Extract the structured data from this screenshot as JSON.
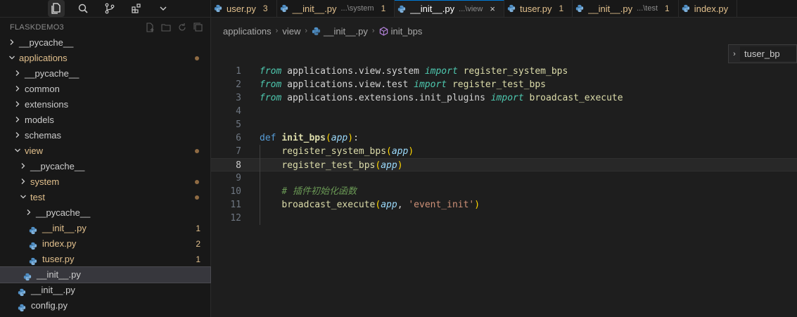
{
  "activity_bar": [
    "explorer-icon",
    "search-icon",
    "source-control-icon",
    "extensions-icon",
    "chevron-down-icon"
  ],
  "explorer": {
    "title": "FLASKDEMO3",
    "tree": [
      {
        "label": "__pycache__",
        "kind": "folder",
        "expanded": false,
        "depth": 0
      },
      {
        "label": "applications",
        "kind": "folder",
        "expanded": true,
        "depth": 0,
        "modified": true
      },
      {
        "label": "__pycache__",
        "kind": "folder",
        "expanded": false,
        "depth": 1
      },
      {
        "label": "common",
        "kind": "folder",
        "expanded": false,
        "depth": 1
      },
      {
        "label": "extensions",
        "kind": "folder",
        "expanded": false,
        "depth": 1
      },
      {
        "label": "models",
        "kind": "folder",
        "expanded": false,
        "depth": 1
      },
      {
        "label": "schemas",
        "kind": "folder",
        "expanded": false,
        "depth": 1
      },
      {
        "label": "view",
        "kind": "folder",
        "expanded": true,
        "depth": 1,
        "modified": true
      },
      {
        "label": "__pycache__",
        "kind": "folder",
        "expanded": false,
        "depth": 2
      },
      {
        "label": "system",
        "kind": "folder",
        "expanded": false,
        "depth": 2,
        "modified": true
      },
      {
        "label": "test",
        "kind": "folder",
        "expanded": true,
        "depth": 2,
        "modified": true
      },
      {
        "label": "__pycache__",
        "kind": "folder",
        "expanded": false,
        "depth": 3
      },
      {
        "label": "__init__.py",
        "kind": "file",
        "depth": 3,
        "count": "1"
      },
      {
        "label": "index.py",
        "kind": "file",
        "depth": 3,
        "count": "2"
      },
      {
        "label": "tuser.py",
        "kind": "file",
        "depth": 3,
        "count": "1"
      },
      {
        "label": "__init__.py",
        "kind": "file",
        "depth": 2,
        "selected": true
      },
      {
        "label": "__init__.py",
        "kind": "file",
        "depth": 1
      },
      {
        "label": "config.py",
        "kind": "file",
        "depth": 1
      }
    ]
  },
  "tabs": [
    {
      "name": "user.py",
      "count": "3",
      "warn": true
    },
    {
      "name": "__init__.py",
      "desc": "...\\system",
      "count": "1",
      "warn": true
    },
    {
      "name": "__init__.py",
      "desc": "...\\view",
      "active": true
    },
    {
      "name": "tuser.py",
      "count": "1",
      "warn": true
    },
    {
      "name": "__init__.py",
      "desc": "...\\test",
      "count": "1",
      "warn": true
    },
    {
      "name": "index.py",
      "count": "",
      "warn": true
    }
  ],
  "breadcrumb": {
    "items": [
      "applications",
      "view",
      "__init__.py",
      "init_bps"
    ]
  },
  "sticky_scroll": {
    "label": "tuser_bp"
  },
  "editor": {
    "current_line": 8,
    "lines": [
      {
        "n": "1",
        "tokens": [
          [
            "kw-c",
            "from"
          ],
          [
            "plain",
            " applications.view.system "
          ],
          [
            "kw-c",
            "import"
          ],
          [
            "plain",
            " "
          ],
          [
            "fn",
            "register_system_bps"
          ]
        ]
      },
      {
        "n": "2",
        "tokens": [
          [
            "kw-c",
            "from"
          ],
          [
            "plain",
            " applications.view.test "
          ],
          [
            "kw-c",
            "import"
          ],
          [
            "plain",
            " "
          ],
          [
            "fn",
            "register_test_bps"
          ]
        ]
      },
      {
        "n": "3",
        "tokens": [
          [
            "kw-c",
            "from"
          ],
          [
            "plain",
            " applications.extensions.init_plugins "
          ],
          [
            "kw-c",
            "import"
          ],
          [
            "plain",
            " "
          ],
          [
            "fn",
            "broadcast_execute"
          ]
        ]
      },
      {
        "n": "4",
        "tokens": []
      },
      {
        "n": "5",
        "tokens": []
      },
      {
        "n": "6",
        "tokens": [
          [
            "kw",
            "def"
          ],
          [
            "plain",
            " "
          ],
          [
            "fnb",
            "init_bps"
          ],
          [
            "pun",
            "("
          ],
          [
            "par",
            "app"
          ],
          [
            "pun",
            ")"
          ],
          [
            "plain",
            ":"
          ]
        ]
      },
      {
        "n": "7",
        "tokens": [
          [
            "plain",
            "    "
          ],
          [
            "fn",
            "register_system_bps"
          ],
          [
            "pun",
            "("
          ],
          [
            "par",
            "app"
          ],
          [
            "pun",
            ")"
          ]
        ]
      },
      {
        "n": "8",
        "tokens": [
          [
            "plain",
            "    "
          ],
          [
            "fn",
            "register_test_bps"
          ],
          [
            "pun",
            "("
          ],
          [
            "par",
            "app"
          ],
          [
            "pun",
            ")"
          ]
        ]
      },
      {
        "n": "9",
        "tokens": []
      },
      {
        "n": "10",
        "tokens": [
          [
            "plain",
            "    "
          ],
          [
            "cmt",
            "# 插件初始化函数"
          ]
        ]
      },
      {
        "n": "11",
        "tokens": [
          [
            "plain",
            "    "
          ],
          [
            "fn",
            "broadcast_execute"
          ],
          [
            "pun",
            "("
          ],
          [
            "par",
            "app"
          ],
          [
            "plain",
            ", "
          ],
          [
            "str",
            "'event_init'"
          ],
          [
            "pun",
            ")"
          ]
        ]
      },
      {
        "n": "12",
        "tokens": []
      }
    ]
  }
}
